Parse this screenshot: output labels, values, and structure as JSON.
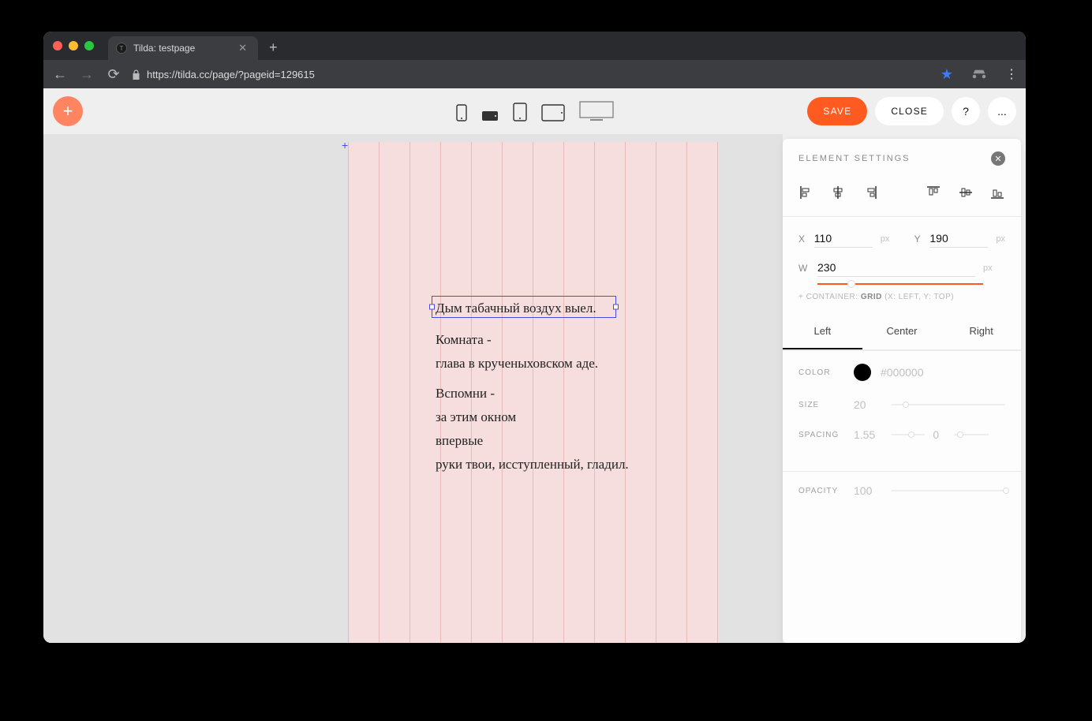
{
  "browser": {
    "tab_title": "Tilda: testpage",
    "url": "https://tilda.cc/page/?pageid=129615"
  },
  "topbar": {
    "save": "SAVE",
    "close": "CLOSE",
    "help": "?",
    "more": "..."
  },
  "canvas": {
    "text_lines": [
      "Дым табачный воздух выел.",
      "Комната -",
      "глава в крученыховском аде.",
      "Вспомни -",
      "за этим окном",
      "впервые",
      "руки твои, исступленный, гладил."
    ]
  },
  "panel": {
    "title": "ELEMENT SETTINGS",
    "x_label": "X",
    "x_value": "110",
    "y_label": "Y",
    "y_value": "190",
    "w_label": "W",
    "w_value": "230",
    "unit": "px",
    "container_prefix": "+ CONTAINER:",
    "container_grid": "GRID",
    "container_xy": "(X: LEFT, Y: TOP)",
    "tabs": {
      "left": "Left",
      "center": "Center",
      "right": "Right"
    },
    "color_label": "COLOR",
    "color_value": "#000000",
    "size_label": "SIZE",
    "size_value": "20",
    "spacing_label": "SPACING",
    "spacing_v1": "1.55",
    "spacing_v2": "0",
    "opacity_label": "OPACITY",
    "opacity_value": "100"
  }
}
